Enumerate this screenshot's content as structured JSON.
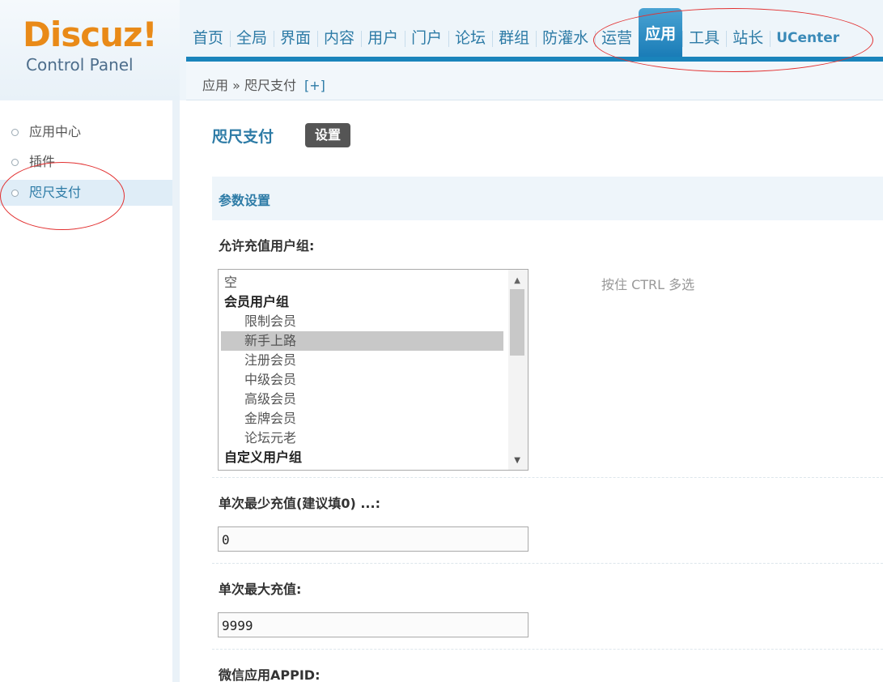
{
  "logo": {
    "brand": "Discuz!",
    "subtitle": "Control Panel"
  },
  "topnav": {
    "items": [
      "首页",
      "全局",
      "界面",
      "内容",
      "用户",
      "门户",
      "论坛",
      "群组",
      "防灌水",
      "运营",
      "应用",
      "工具",
      "站长",
      "UCenter"
    ],
    "active_index": 10
  },
  "breadcrumb": {
    "path": "应用 » 咫尺支付",
    "add_label": "[+]"
  },
  "sidebar": {
    "items": [
      {
        "label": "应用中心"
      },
      {
        "label": "插件"
      },
      {
        "label": "咫尺支付"
      }
    ],
    "active_index": 2
  },
  "main": {
    "title": "咫尺支付",
    "settings_tab": "设置",
    "section_title": "参数设置",
    "fields": {
      "allowed_groups": {
        "label": "允许充值用户组:",
        "hint": "按住 CTRL 多选",
        "options": [
          {
            "label": "空",
            "type": "normal"
          },
          {
            "label": "会员用户组",
            "type": "group"
          },
          {
            "label": "限制会员",
            "type": "indent"
          },
          {
            "label": "新手上路",
            "type": "indent",
            "selected": true
          },
          {
            "label": "注册会员",
            "type": "indent"
          },
          {
            "label": "中级会员",
            "type": "indent"
          },
          {
            "label": "高级会员",
            "type": "indent"
          },
          {
            "label": "金牌会员",
            "type": "indent"
          },
          {
            "label": "论坛元老",
            "type": "indent"
          },
          {
            "label": "自定义用户组",
            "type": "group"
          }
        ]
      },
      "min_recharge": {
        "label": "单次最少充值(建议填0) ...:",
        "value": "0"
      },
      "max_recharge": {
        "label": "单次最大充值:",
        "value": "9999"
      },
      "wechat_appid": {
        "label": "微信应用APPID:"
      }
    }
  },
  "colors": {
    "accent": "#1a84bb",
    "brand": "#e98a18",
    "annotation": "#e23030"
  }
}
